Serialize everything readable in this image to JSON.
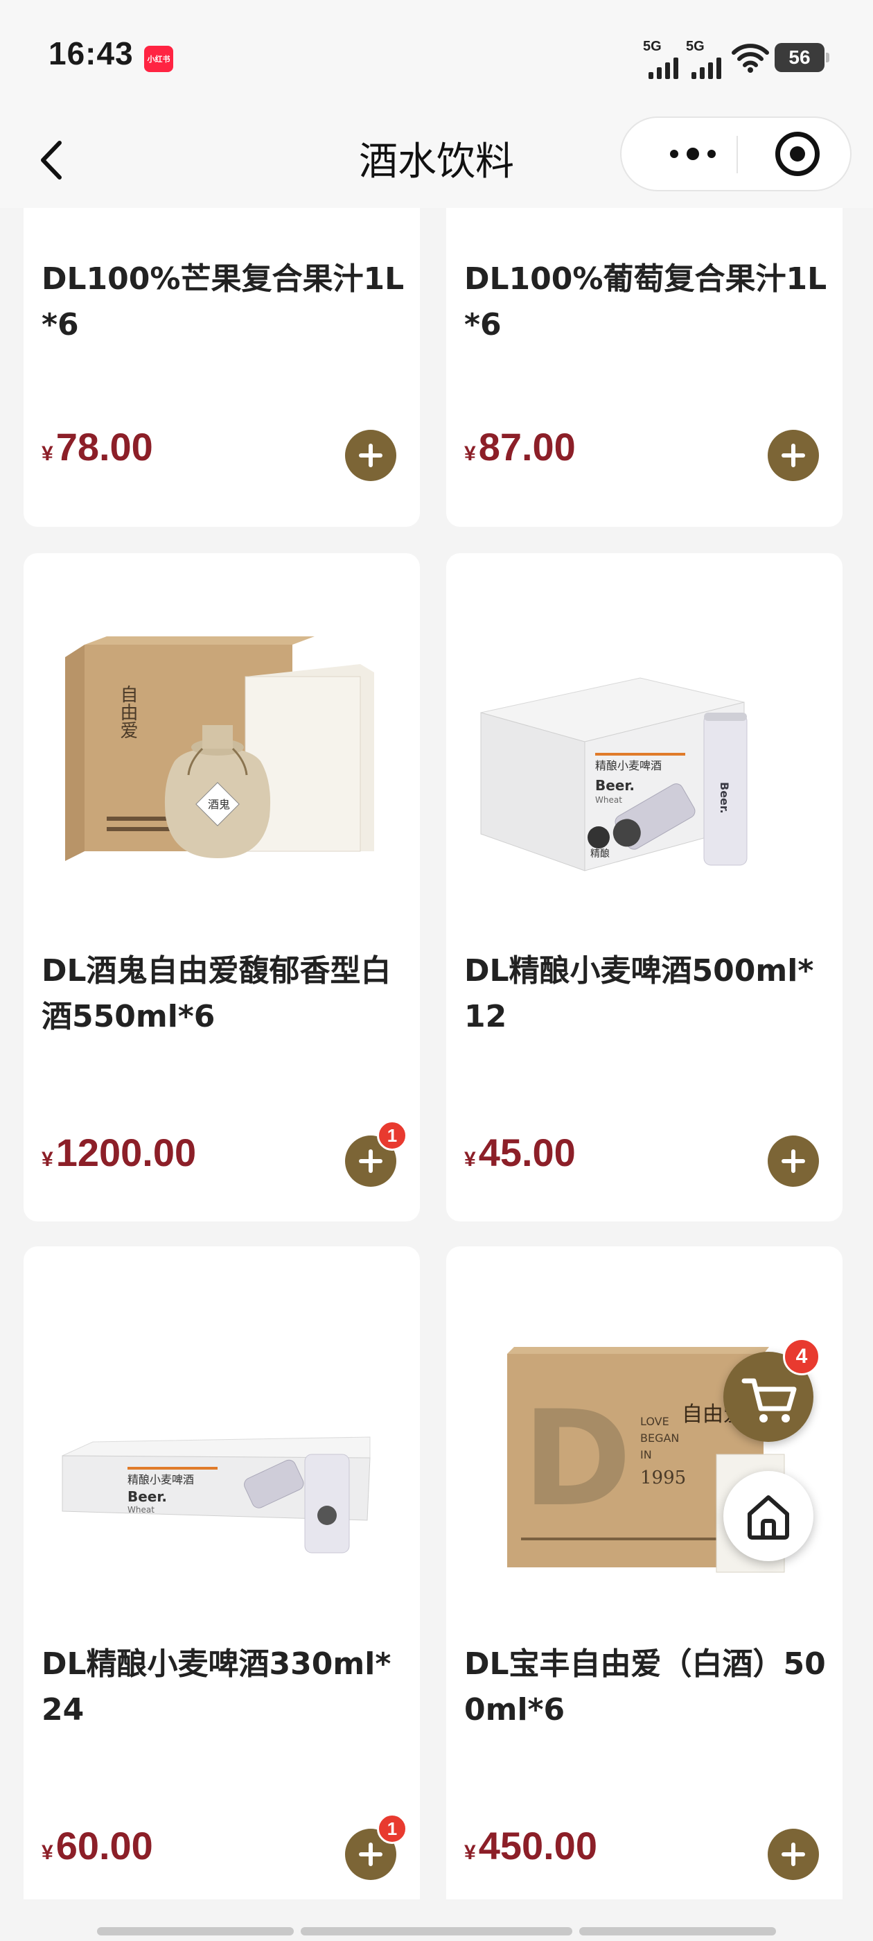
{
  "status_bar": {
    "time": "16:43",
    "app_badge": "小红书",
    "sim1": "5G",
    "sim2": "5G",
    "battery": "56"
  },
  "nav": {
    "title": "酒水饮料"
  },
  "products": [
    {
      "name": "DL100%芒果复合果汁1L*6",
      "currency": "¥",
      "price": "78.00",
      "qty": ""
    },
    {
      "name": "DL100%葡萄复合果汁1L*6",
      "currency": "¥",
      "price": "87.00",
      "qty": ""
    },
    {
      "name": "DL酒鬼自由爱馥郁香型白酒550ml*6",
      "currency": "¥",
      "price": "1200.00",
      "qty": "1"
    },
    {
      "name": "DL精酿小麦啤酒500ml*12",
      "currency": "¥",
      "price": "45.00",
      "qty": ""
    },
    {
      "name": "DL精酿小麦啤酒330ml*24",
      "currency": "¥",
      "price": "60.00",
      "qty": "1"
    },
    {
      "name": "DL宝丰自由爱（白酒）500ml*6",
      "currency": "¥",
      "price": "450.00",
      "qty": ""
    }
  ],
  "product_images": {
    "box_brand": "自由爱",
    "pot_label": "酒鬼",
    "beer_brand": "Beer.",
    "beer_sub": "Wheat",
    "beer_cn": "精酿小麦啤酒",
    "beer_badge": "精酿",
    "baofeng_love": "LOVE",
    "baofeng_began": "BEGAN",
    "baofeng_in": "IN",
    "baofeng_year": "1995"
  },
  "cart": {
    "count": "4"
  },
  "colors": {
    "accent": "#7c6536",
    "price": "#8c1f28",
    "badge": "#e83a2f"
  }
}
